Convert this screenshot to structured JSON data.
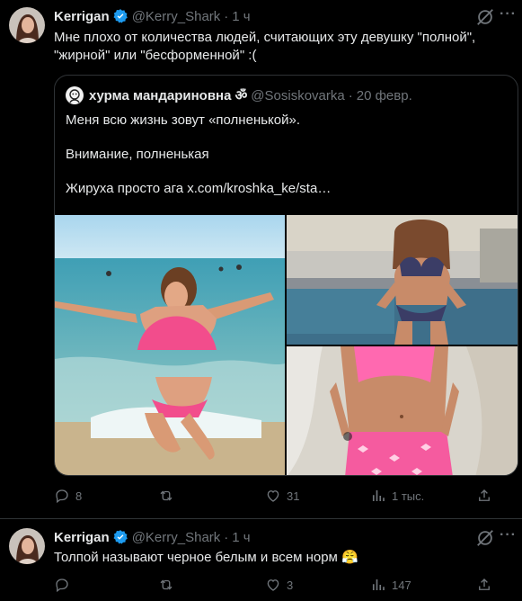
{
  "tweets": [
    {
      "author": {
        "name": "Kerrigan",
        "handle": "@Kerry_Shark",
        "time": "1 ч",
        "verified": true
      },
      "text": "Мне плохо от количества людей, считающих эту девушку \"полной\",\n\"жирной\" или \"бесформенной\" :(",
      "quote": {
        "author": {
          "name": "хурма мандариновна ॐ",
          "handle": "@Sosiskovarka",
          "time": "20 февр."
        },
        "lines": [
          "Меня всю жизнь зовут «полненькой».",
          "Внимание, полненькая",
          "Жируха просто ага  x.com/kroshka_ke/sta…"
        ]
      },
      "stats": {
        "replies": "8",
        "retweets": "",
        "likes": "31",
        "views": "1 тыс."
      }
    },
    {
      "author": {
        "name": "Kerrigan",
        "handle": "@Kerry_Shark",
        "time": "1 ч",
        "verified": true
      },
      "text": "Толпой называют черное белым и всем норм 😤",
      "stats": {
        "replies": "",
        "retweets": "",
        "likes": "3",
        "views": "147"
      }
    }
  ],
  "icons": [
    "grok-icon",
    "more-icon",
    "verified-icon",
    "reply-icon",
    "retweet-icon",
    "like-icon",
    "views-icon",
    "share-icon"
  ],
  "colors": {
    "background": "#000000",
    "text": "#e7e9ea",
    "secondary": "#71767b",
    "border": "#2f3336",
    "verified": "#1d9bf0"
  }
}
